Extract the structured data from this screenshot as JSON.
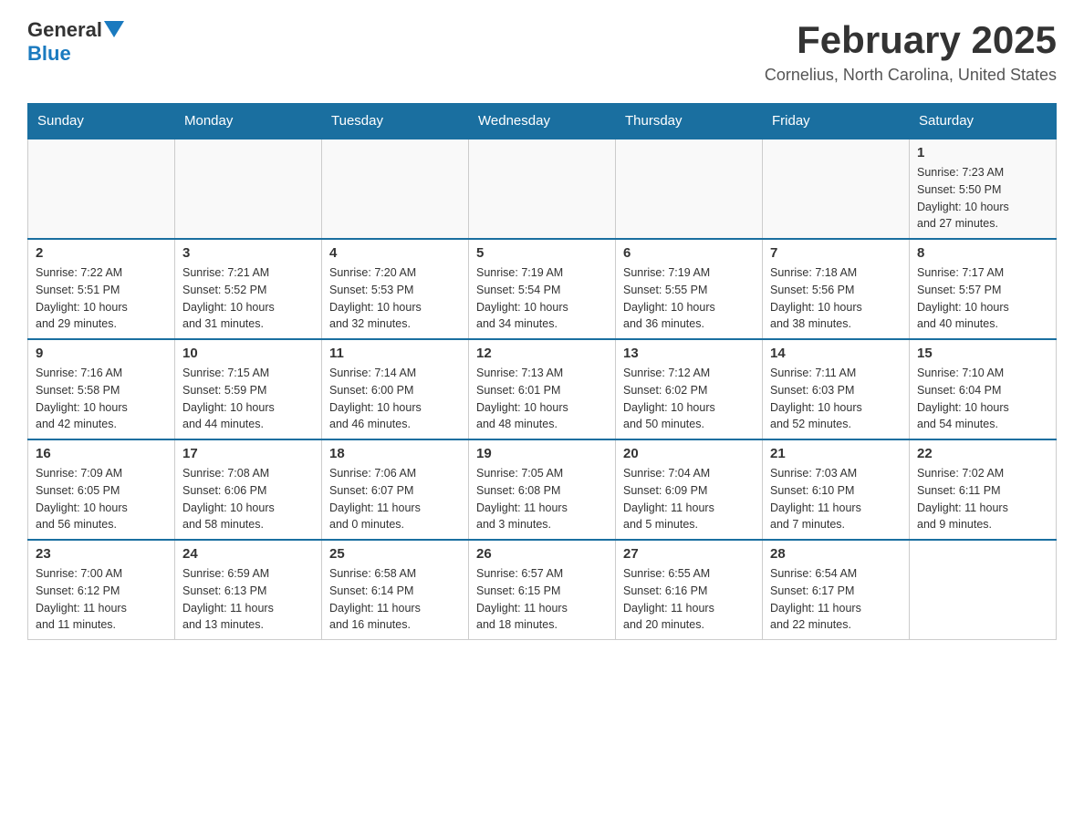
{
  "logo": {
    "text_general": "General",
    "text_blue": "Blue",
    "arrow": "▲"
  },
  "title": "February 2025",
  "subtitle": "Cornelius, North Carolina, United States",
  "days_of_week": [
    "Sunday",
    "Monday",
    "Tuesday",
    "Wednesday",
    "Thursday",
    "Friday",
    "Saturday"
  ],
  "weeks": [
    [
      {
        "day": "",
        "info": ""
      },
      {
        "day": "",
        "info": ""
      },
      {
        "day": "",
        "info": ""
      },
      {
        "day": "",
        "info": ""
      },
      {
        "day": "",
        "info": ""
      },
      {
        "day": "",
        "info": ""
      },
      {
        "day": "1",
        "info": "Sunrise: 7:23 AM\nSunset: 5:50 PM\nDaylight: 10 hours\nand 27 minutes."
      }
    ],
    [
      {
        "day": "2",
        "info": "Sunrise: 7:22 AM\nSunset: 5:51 PM\nDaylight: 10 hours\nand 29 minutes."
      },
      {
        "day": "3",
        "info": "Sunrise: 7:21 AM\nSunset: 5:52 PM\nDaylight: 10 hours\nand 31 minutes."
      },
      {
        "day": "4",
        "info": "Sunrise: 7:20 AM\nSunset: 5:53 PM\nDaylight: 10 hours\nand 32 minutes."
      },
      {
        "day": "5",
        "info": "Sunrise: 7:19 AM\nSunset: 5:54 PM\nDaylight: 10 hours\nand 34 minutes."
      },
      {
        "day": "6",
        "info": "Sunrise: 7:19 AM\nSunset: 5:55 PM\nDaylight: 10 hours\nand 36 minutes."
      },
      {
        "day": "7",
        "info": "Sunrise: 7:18 AM\nSunset: 5:56 PM\nDaylight: 10 hours\nand 38 minutes."
      },
      {
        "day": "8",
        "info": "Sunrise: 7:17 AM\nSunset: 5:57 PM\nDaylight: 10 hours\nand 40 minutes."
      }
    ],
    [
      {
        "day": "9",
        "info": "Sunrise: 7:16 AM\nSunset: 5:58 PM\nDaylight: 10 hours\nand 42 minutes."
      },
      {
        "day": "10",
        "info": "Sunrise: 7:15 AM\nSunset: 5:59 PM\nDaylight: 10 hours\nand 44 minutes."
      },
      {
        "day": "11",
        "info": "Sunrise: 7:14 AM\nSunset: 6:00 PM\nDaylight: 10 hours\nand 46 minutes."
      },
      {
        "day": "12",
        "info": "Sunrise: 7:13 AM\nSunset: 6:01 PM\nDaylight: 10 hours\nand 48 minutes."
      },
      {
        "day": "13",
        "info": "Sunrise: 7:12 AM\nSunset: 6:02 PM\nDaylight: 10 hours\nand 50 minutes."
      },
      {
        "day": "14",
        "info": "Sunrise: 7:11 AM\nSunset: 6:03 PM\nDaylight: 10 hours\nand 52 minutes."
      },
      {
        "day": "15",
        "info": "Sunrise: 7:10 AM\nSunset: 6:04 PM\nDaylight: 10 hours\nand 54 minutes."
      }
    ],
    [
      {
        "day": "16",
        "info": "Sunrise: 7:09 AM\nSunset: 6:05 PM\nDaylight: 10 hours\nand 56 minutes."
      },
      {
        "day": "17",
        "info": "Sunrise: 7:08 AM\nSunset: 6:06 PM\nDaylight: 10 hours\nand 58 minutes."
      },
      {
        "day": "18",
        "info": "Sunrise: 7:06 AM\nSunset: 6:07 PM\nDaylight: 11 hours\nand 0 minutes."
      },
      {
        "day": "19",
        "info": "Sunrise: 7:05 AM\nSunset: 6:08 PM\nDaylight: 11 hours\nand 3 minutes."
      },
      {
        "day": "20",
        "info": "Sunrise: 7:04 AM\nSunset: 6:09 PM\nDaylight: 11 hours\nand 5 minutes."
      },
      {
        "day": "21",
        "info": "Sunrise: 7:03 AM\nSunset: 6:10 PM\nDaylight: 11 hours\nand 7 minutes."
      },
      {
        "day": "22",
        "info": "Sunrise: 7:02 AM\nSunset: 6:11 PM\nDaylight: 11 hours\nand 9 minutes."
      }
    ],
    [
      {
        "day": "23",
        "info": "Sunrise: 7:00 AM\nSunset: 6:12 PM\nDaylight: 11 hours\nand 11 minutes."
      },
      {
        "day": "24",
        "info": "Sunrise: 6:59 AM\nSunset: 6:13 PM\nDaylight: 11 hours\nand 13 minutes."
      },
      {
        "day": "25",
        "info": "Sunrise: 6:58 AM\nSunset: 6:14 PM\nDaylight: 11 hours\nand 16 minutes."
      },
      {
        "day": "26",
        "info": "Sunrise: 6:57 AM\nSunset: 6:15 PM\nDaylight: 11 hours\nand 18 minutes."
      },
      {
        "day": "27",
        "info": "Sunrise: 6:55 AM\nSunset: 6:16 PM\nDaylight: 11 hours\nand 20 minutes."
      },
      {
        "day": "28",
        "info": "Sunrise: 6:54 AM\nSunset: 6:17 PM\nDaylight: 11 hours\nand 22 minutes."
      },
      {
        "day": "",
        "info": ""
      }
    ]
  ]
}
